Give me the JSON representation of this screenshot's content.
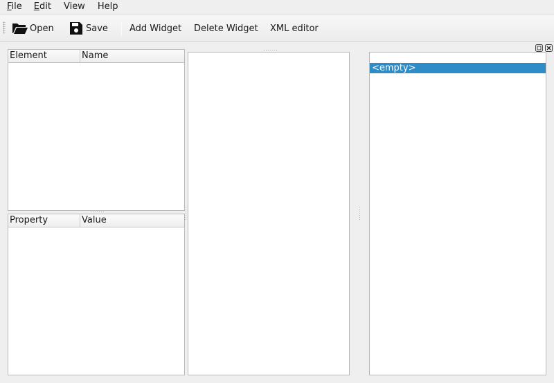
{
  "menubar": {
    "items": [
      {
        "mnemonic": "F",
        "rest": "ile"
      },
      {
        "mnemonic": "E",
        "rest": "dit"
      },
      {
        "label": "View"
      },
      {
        "label": "Help"
      }
    ]
  },
  "toolbar": {
    "open_label": "Open",
    "save_label": "Save",
    "add_widget_label": "Add Widget",
    "delete_widget_label": "Delete Widget",
    "xml_editor_label": "XML editor",
    "icons": [
      "folder-open-icon",
      "floppy-save-icon"
    ]
  },
  "element_tree": {
    "columns": [
      "Element",
      "Name"
    ]
  },
  "property_table": {
    "columns": [
      "Property",
      "Value"
    ]
  },
  "right_dock": {
    "selected_item": "<empty>",
    "dock_buttons": [
      "float-icon",
      "close-icon"
    ]
  },
  "colors": {
    "selection": "#308cc6",
    "window_bg": "#efefef",
    "panel_bg": "#ffffff",
    "border": "#b9b9b9"
  }
}
